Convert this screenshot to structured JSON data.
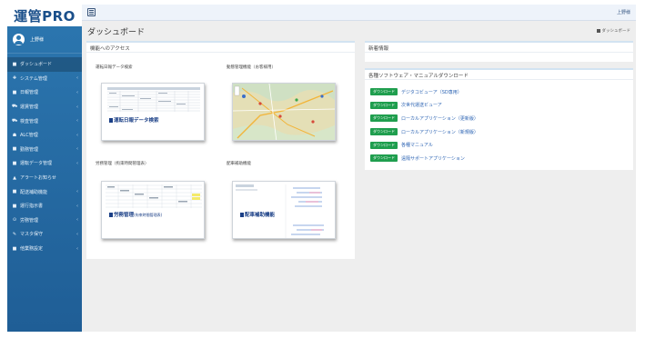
{
  "app": {
    "logo": "運管PRO"
  },
  "sidebar": {
    "user_name": "上野様",
    "items": [
      {
        "label": "ダッシュボード",
        "icon": "■",
        "arrow": ""
      },
      {
        "label": "システム管理",
        "icon": "✚",
        "arrow": "‹"
      },
      {
        "label": "日報管理",
        "icon": "■",
        "arrow": "‹"
      },
      {
        "label": "運賃管理",
        "icon": "⛟",
        "arrow": "‹"
      },
      {
        "label": "検査管理",
        "icon": "⛟",
        "arrow": "‹"
      },
      {
        "label": "ALC管理",
        "icon": "☗",
        "arrow": "‹"
      },
      {
        "label": "勤務管理",
        "icon": "■",
        "arrow": "‹"
      },
      {
        "label": "運転データ管理",
        "icon": "■",
        "arrow": "‹"
      },
      {
        "label": "アラートお知らせ",
        "icon": "▲",
        "arrow": ""
      },
      {
        "label": "配送補助機能",
        "icon": "■",
        "arrow": "‹"
      },
      {
        "label": "運行指示書",
        "icon": "■",
        "arrow": "‹"
      },
      {
        "label": "労務管理",
        "icon": "⊙",
        "arrow": "‹"
      },
      {
        "label": "マスタ保守",
        "icon": "✎",
        "arrow": "‹"
      },
      {
        "label": "他業務設定",
        "icon": "■",
        "arrow": "‹"
      }
    ]
  },
  "topbar": {
    "user": "上野様"
  },
  "page": {
    "title": "ダッシュボード",
    "breadcrumb": "ダッシュボード"
  },
  "access": {
    "title": "機能へのアクセス",
    "cards": [
      {
        "label": "運転日報データ検索",
        "caption": "運転日報データ検索",
        "sub": ""
      },
      {
        "label": "動態管理機能（お客様用）",
        "caption": "",
        "sub": ""
      },
      {
        "label": "労務管理（拘束時間管理表）",
        "caption": "労務管理",
        "sub": "(拘束時間管理表)"
      },
      {
        "label": "配車補助機能",
        "caption": "配車補助機能",
        "sub": ""
      }
    ]
  },
  "news": {
    "title": "新着情報"
  },
  "downloads": {
    "title": "各種ソフトウェア・マニュアルダウンロード",
    "badge": "ダウンロード",
    "items": [
      "デジタコビューア（SD専用）",
      "次世代運送ビューア",
      "ローカルアプリケーション（更新版）",
      "ローカルアプリケーション（新規版）",
      "各種マニュアル",
      "遠隔サポートアプリケーション"
    ]
  },
  "colors": {
    "sidebar": "#2c77b0",
    "badge": "#1f9e4e",
    "link": "#2b63b3",
    "caption": "#1a3f86"
  }
}
